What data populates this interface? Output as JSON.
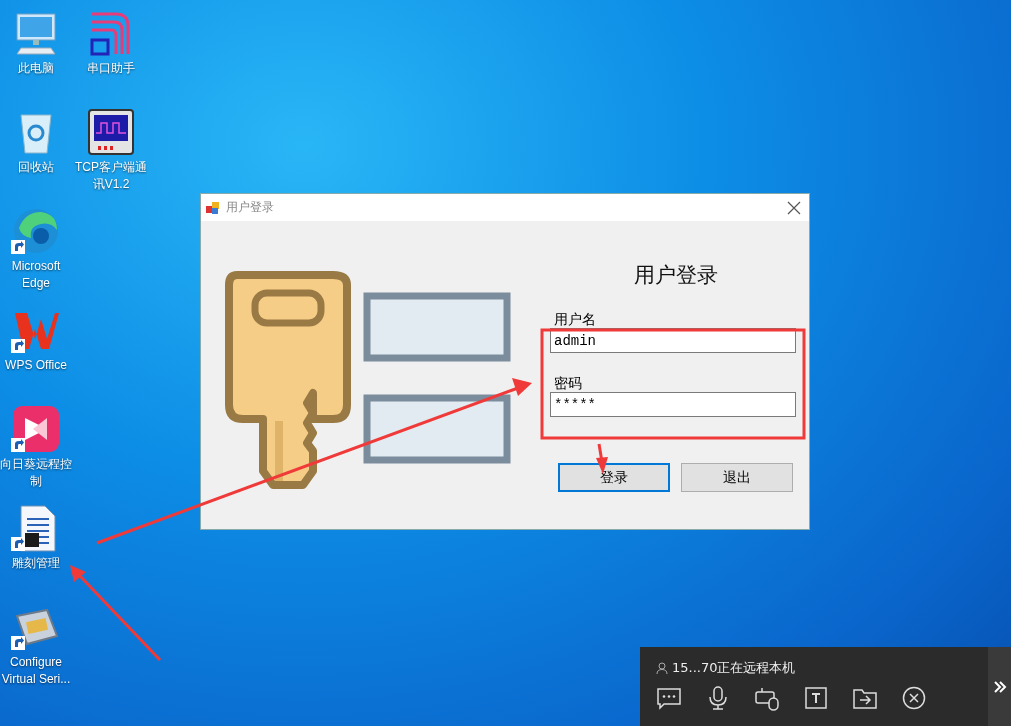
{
  "desktop_icons": [
    {
      "label": "此电脑",
      "kind": "pc",
      "shortcut": false
    },
    {
      "label": "回收站",
      "kind": "bin",
      "shortcut": false
    },
    {
      "label": "Microsoft Edge",
      "kind": "edge",
      "shortcut": true
    },
    {
      "label": "WPS Office",
      "kind": "wps",
      "shortcut": true
    },
    {
      "label": "向日葵远程控制",
      "kind": "sunlogin",
      "shortcut": true
    },
    {
      "label": "雕刻管理",
      "kind": "doc",
      "shortcut": true
    },
    {
      "label": "Configure Virtual Seri...",
      "kind": "cable",
      "shortcut": true
    },
    {
      "label": "串口助手",
      "kind": "serial",
      "shortcut": false
    },
    {
      "label": "TCP客户端通讯V1.2",
      "kind": "scope",
      "shortcut": false
    }
  ],
  "dialog": {
    "title": "用户登录",
    "heading": "用户登录",
    "fields": [
      {
        "label": "用户名",
        "value": "admin"
      },
      {
        "label": "密码",
        "value": "*****"
      }
    ],
    "buttons": [
      {
        "label": "登录",
        "focused": true
      },
      {
        "label": "退出",
        "focused": false
      }
    ]
  },
  "remote_panel": {
    "status": "15...70正在远程本机"
  }
}
